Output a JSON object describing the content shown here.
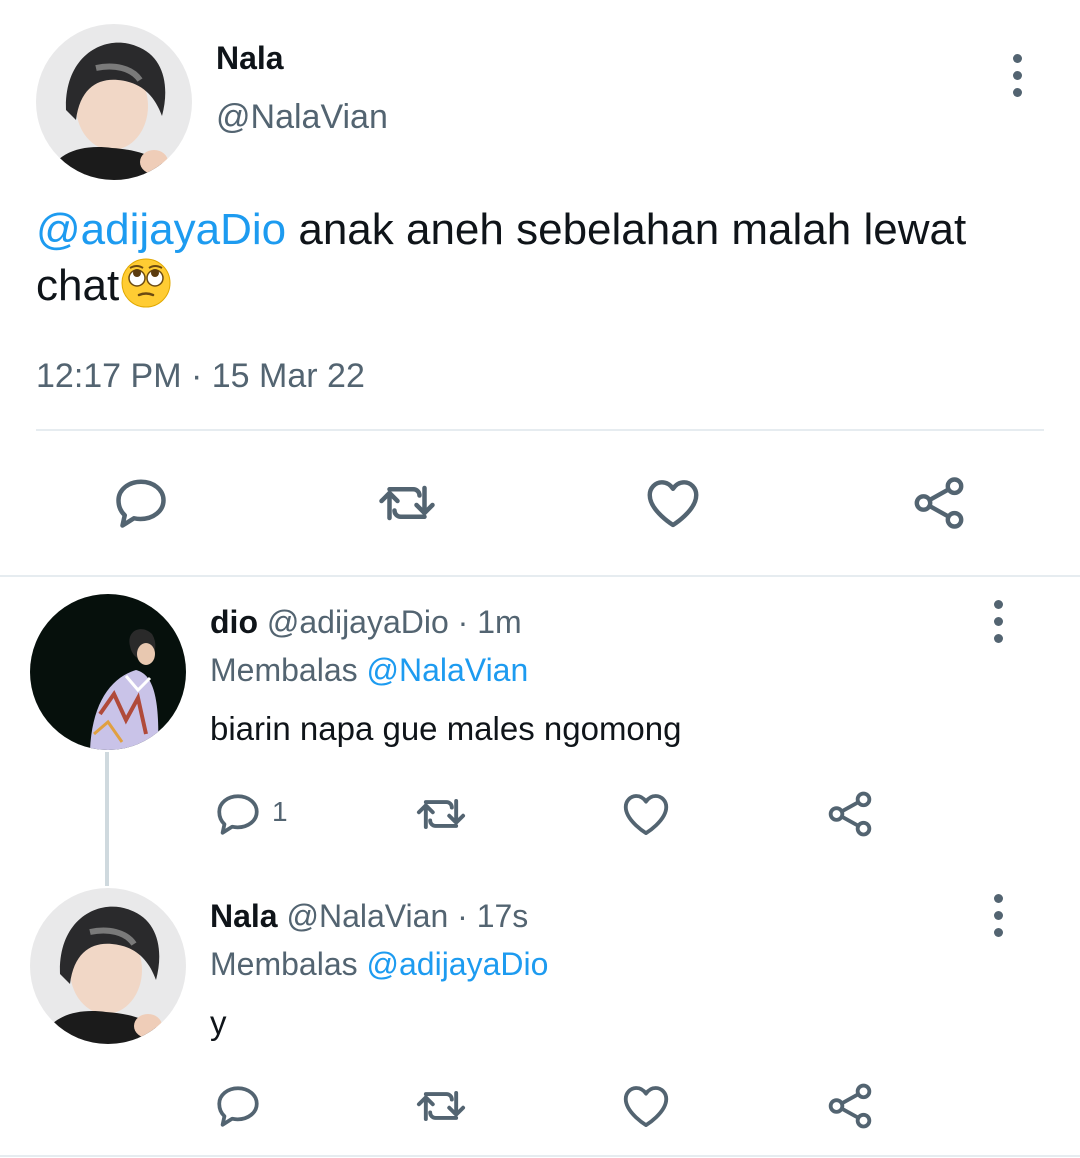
{
  "main_tweet": {
    "display_name": "Nala",
    "handle": "@NalaVian",
    "mention": "@adijayaDio",
    "text": " anak aneh sebelahan malah lewat chat",
    "emoji": "face-with-rolling-eyes",
    "time": "12:17 PM",
    "separator": "·",
    "date": "15 Mar 22"
  },
  "replies": [
    {
      "display_name": "dio",
      "handle": "@adijayaDio",
      "separator": "·",
      "age": "1m",
      "replying_prefix": "Membalas ",
      "replying_to": "@NalaVian",
      "text": "biarin napa gue males ngomong",
      "reply_count": "1"
    },
    {
      "display_name": "Nala",
      "handle": "@NalaVian",
      "separator": "·",
      "age": "17s",
      "replying_prefix": "Membalas ",
      "replying_to": "@adijayaDio",
      "text": "y",
      "reply_count": ""
    }
  ],
  "icons": {
    "reply": "reply-icon",
    "retweet": "retweet-icon",
    "like": "heart-icon",
    "share": "share-icon",
    "more": "more-vertical-icon"
  },
  "colors": {
    "link": "#1d9bf0",
    "muted": "#536471",
    "text": "#0f1419",
    "divider": "#e6ecf0"
  }
}
